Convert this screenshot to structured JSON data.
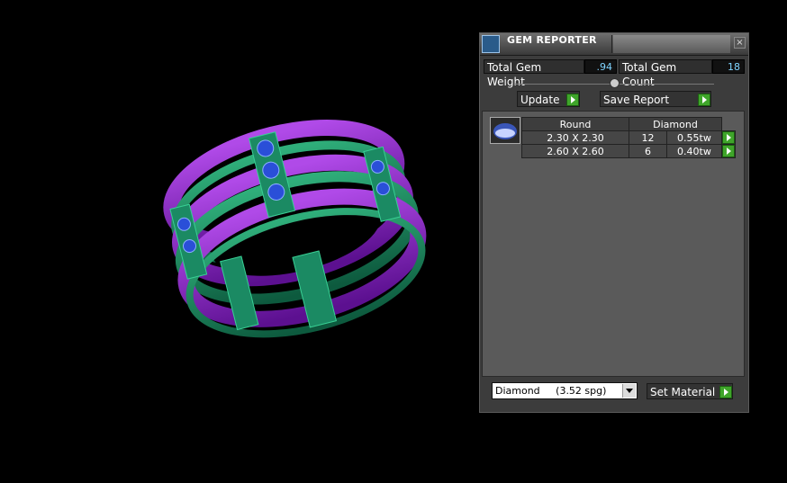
{
  "panel": {
    "title": "GEM REPORTER",
    "close_glyph": "×",
    "total_weight_label": "Total Gem Weight",
    "total_weight_value": ".94",
    "total_count_label": "Total Gem Count",
    "total_count_value": "18",
    "update_label": "Update",
    "save_report_label": "Save Report",
    "table": {
      "headers": [
        "Round",
        "Diamond"
      ],
      "rows": [
        {
          "size": "2.30 X 2.30",
          "count": "12",
          "weight": "0.55tw"
        },
        {
          "size": "2.60 X 2.60",
          "count": "6",
          "weight": "0.40tw"
        }
      ]
    },
    "material_select": {
      "value": "Diamond     (3.52 spg)"
    },
    "set_material_label": "Set Material"
  },
  "colors": {
    "accent_green": "#3fa52a",
    "ring_purple": "#8a1fc4",
    "ring_green": "#17835e",
    "gem_blue": "#2a4fd8"
  },
  "icons": [
    "app-icon",
    "close-icon",
    "play-icon",
    "gem-icon",
    "chevron-down-icon"
  ]
}
